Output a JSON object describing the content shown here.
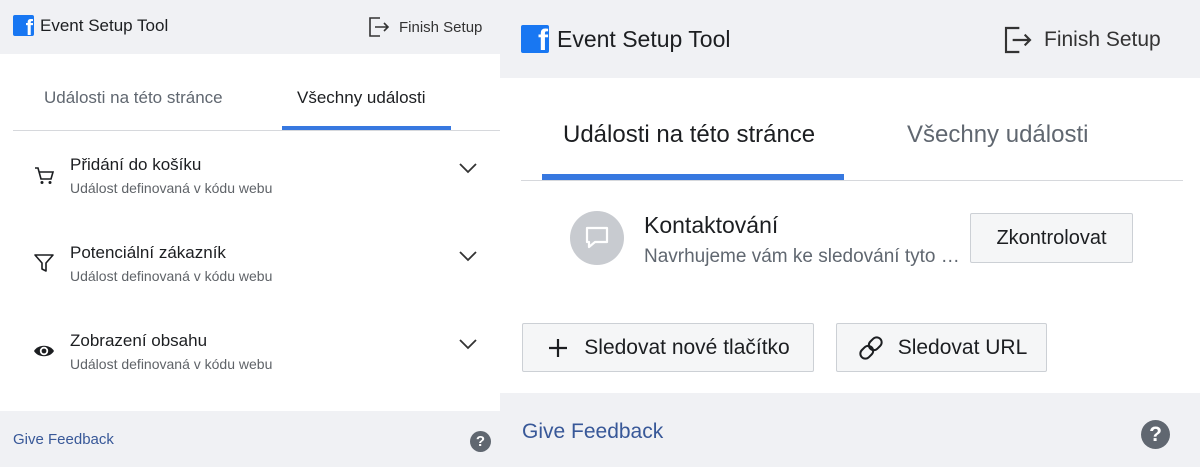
{
  "left": {
    "header": {
      "title": "Event Setup Tool",
      "finish_label": "Finish Setup"
    },
    "tabs": [
      {
        "label": "Události na této stránce",
        "active": false
      },
      {
        "label": "Všechny události",
        "active": true
      }
    ],
    "events": [
      {
        "title": "Přidání do košíku",
        "subtitle": "Událost definovaná v kódu webu",
        "icon": "cart-icon"
      },
      {
        "title": "Potenciální zákazník",
        "subtitle": "Událost definovaná v kódu webu",
        "icon": "filter-icon"
      },
      {
        "title": "Zobrazení obsahu",
        "subtitle": "Událost definovaná v kódu webu",
        "icon": "eye-icon"
      }
    ],
    "footer": {
      "feedback_label": "Give Feedback",
      "help_glyph": "?"
    }
  },
  "right": {
    "header": {
      "title": "Event Setup Tool",
      "finish_label": "Finish Setup"
    },
    "tabs": [
      {
        "label": "Události na této stránce",
        "active": true
      },
      {
        "label": "Všechny události",
        "active": false
      }
    ],
    "suggestion": {
      "title": "Kontaktování",
      "subtitle": "Navrhujeme vám ke sledování tyto události",
      "button_label": "Zkontrolovat"
    },
    "actions": {
      "track_button_label": "Sledovat nové tlačítko",
      "track_url_label": "Sledovat URL"
    },
    "footer": {
      "feedback_label": "Give Feedback",
      "help_glyph": "?"
    }
  },
  "colors": {
    "accent": "#3778e0",
    "facebook_blue": "#1877f2",
    "link": "#385898",
    "header_bg": "#f0f1f4"
  },
  "logo_glyph": "f"
}
